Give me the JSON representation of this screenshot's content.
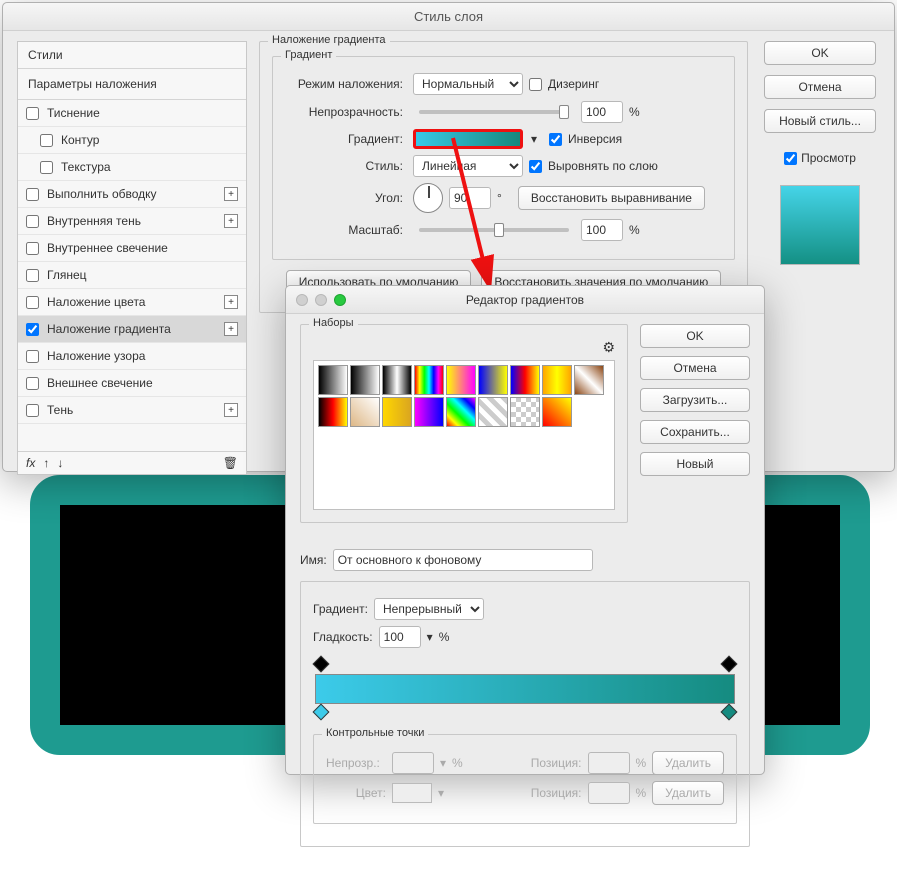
{
  "layer_style": {
    "title": "Стиль слоя",
    "styles_header": "Стили",
    "overlay_params": "Параметры наложения",
    "effects": {
      "emboss": "Тиснение",
      "contour": "Контур",
      "texture": "Текстура",
      "stroke": "Выполнить обводку",
      "inner_shadow": "Внутренняя тень",
      "inner_glow": "Внутреннее свечение",
      "satin": "Глянец",
      "color_overlay": "Наложение цвета",
      "gradient_overlay": "Наложение градиента",
      "pattern_overlay": "Наложение узора",
      "outer_glow": "Внешнее свечение",
      "drop_shadow": "Тень"
    },
    "fx_label": "fx",
    "panel_legend": "Наложение градиента",
    "gradient_legend": "Градиент",
    "blend_mode": {
      "label": "Режим наложения:",
      "value": "Нормальный"
    },
    "dither": "Дизеринг",
    "opacity": {
      "label": "Непрозрачность:",
      "value": "100",
      "suffix": "%"
    },
    "gradient_label": "Градиент:",
    "reverse": "Инверсия",
    "style": {
      "label": "Стиль:",
      "value": "Линейная"
    },
    "align_layer": "Выровнять по слою",
    "angle": {
      "label": "Угол:",
      "value": "90",
      "suffix": "°"
    },
    "reset_align": "Восстановить выравнивание",
    "scale": {
      "label": "Масштаб:",
      "value": "100",
      "suffix": "%"
    },
    "make_default": "Использовать по умолчанию",
    "reset_default": "Восстановить значения по умолчанию",
    "buttons": {
      "ok": "OK",
      "cancel": "Отмена",
      "new_style": "Новый стиль..."
    },
    "preview_label": "Просмотр"
  },
  "gradient_editor": {
    "title": "Редактор градиентов",
    "presets_label": "Наборы",
    "buttons": {
      "ok": "OK",
      "cancel": "Отмена",
      "load": "Загрузить...",
      "save": "Сохранить...",
      "new": "Новый"
    },
    "name_label": "Имя:",
    "name_value": "От основного к фоновому",
    "type": {
      "label": "Градиент:",
      "value": "Непрерывный"
    },
    "smoothness": {
      "label": "Гладкость:",
      "value": "100",
      "suffix": "%"
    },
    "stops_legend": "Контрольные точки",
    "opacity_lbl": "Непрозр.:",
    "position_lbl": "Позиция:",
    "color_lbl": "Цвет:",
    "delete": "Удалить",
    "percent": "%",
    "preset_gradients": [
      "linear-gradient(90deg,#000,#fff)",
      "linear-gradient(90deg,#000,transparent)",
      "linear-gradient(90deg,#000,#fff,#000)",
      "linear-gradient(90deg,#f00,#ff0,#0f0,#0ff,#00f,#f0f,#f00)",
      "linear-gradient(90deg,#ff0,#f0f)",
      "linear-gradient(90deg,#00f,#ff0)",
      "linear-gradient(90deg,#00f,#f00,#ff0)",
      "linear-gradient(90deg,#ffa500,#ff0,#ffa500)",
      "linear-gradient(45deg,#8b4513,#fff,#8b4513)",
      "linear-gradient(90deg,#000,#f00,#ff0)",
      "linear-gradient(45deg,#deb887,#fff)",
      "linear-gradient(90deg,#ffd700,#daa520)",
      "linear-gradient(90deg,#f0f,#00f)",
      "linear-gradient(45deg,#f00,#ff0,#0f0,#0ff,#00f,#f0f)",
      "repeating-linear-gradient(45deg,#fff 0 5px,#ccc 5px 10px)",
      "repeating-conic-gradient(#ccc 0 25%,#fff 0 50%) 0/10px 10px",
      "linear-gradient(45deg,#f00,#ff0)"
    ]
  }
}
